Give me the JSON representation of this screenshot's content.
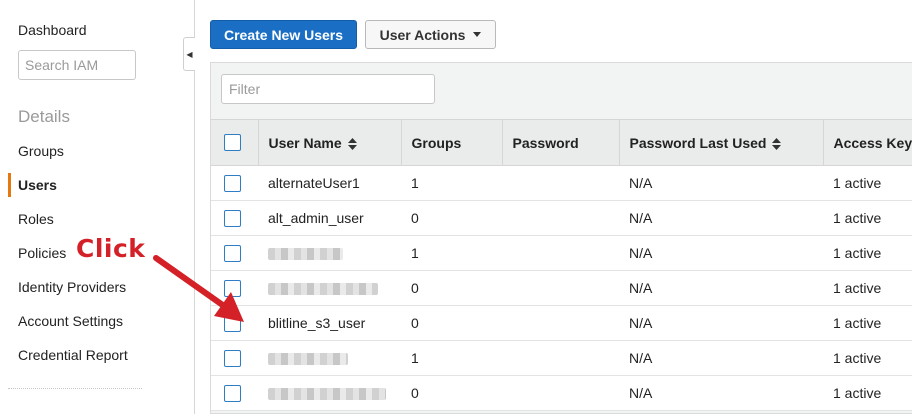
{
  "sidebar": {
    "dashboard": "Dashboard",
    "search_placeholder": "Search IAM",
    "section_title": "Details",
    "items": [
      {
        "label": "Groups"
      },
      {
        "label": "Users"
      },
      {
        "label": "Roles"
      },
      {
        "label": "Policies"
      },
      {
        "label": "Identity Providers"
      },
      {
        "label": "Account Settings"
      },
      {
        "label": "Credential Report"
      }
    ],
    "active_item": "Users"
  },
  "toolbar": {
    "create_label": "Create New Users",
    "actions_label": "User Actions"
  },
  "filter": {
    "placeholder": "Filter"
  },
  "table": {
    "columns": [
      "User Name",
      "Groups",
      "Password",
      "Password Last Used",
      "Access Keys"
    ],
    "rows": [
      {
        "user": "alternateUser1",
        "groups": "1",
        "password": "",
        "last_used": "N/A",
        "keys": "1 active",
        "redacted": false
      },
      {
        "user": "alt_admin_user",
        "groups": "0",
        "password": "",
        "last_used": "N/A",
        "keys": "1 active",
        "redacted": false
      },
      {
        "user": "",
        "groups": "1",
        "password": "",
        "last_used": "N/A",
        "keys": "1 active",
        "redacted": true
      },
      {
        "user": "",
        "groups": "0",
        "password": "",
        "last_used": "N/A",
        "keys": "1 active",
        "redacted": true
      },
      {
        "user": "blitline_s3_user",
        "groups": "0",
        "password": "",
        "last_used": "N/A",
        "keys": "1 active",
        "redacted": false
      },
      {
        "user": "",
        "groups": "1",
        "password": "",
        "last_used": "N/A",
        "keys": "1 active",
        "redacted": true
      },
      {
        "user": "",
        "groups": "0",
        "password": "",
        "last_used": "N/A",
        "keys": "1 active",
        "redacted": true
      }
    ]
  },
  "annotation": {
    "text": "Click",
    "color": "#d42027"
  },
  "colors": {
    "primary": "#1a6fc4",
    "active_indicator": "#e47911",
    "checkbox_border": "#2f7dc4"
  }
}
